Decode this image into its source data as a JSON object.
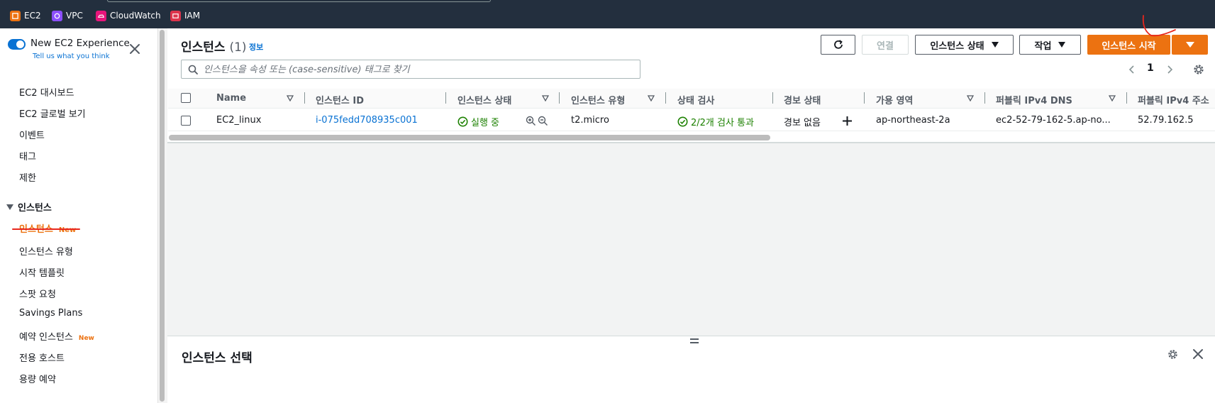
{
  "favorites": [
    {
      "label": "EC2",
      "color": "#ec7211"
    },
    {
      "label": "VPC",
      "color": "#8c4fff"
    },
    {
      "label": "CloudWatch",
      "color": "#e7157b"
    },
    {
      "label": "IAM",
      "color": "#dd344c"
    }
  ],
  "sidebar": {
    "experience_label": "New EC2 Experience",
    "feedback_link": "Tell us what you think",
    "items_top": [
      "EC2 대시보드",
      "EC2 글로벌 보기",
      "이벤트",
      "태그",
      "제한"
    ],
    "section_title": "인스턴스",
    "active_item": "인스턴스",
    "active_badge": "New",
    "items_bottom": [
      "인스턴스 유형",
      "시작 템플릿",
      "스팟 요청",
      "Savings Plans",
      "예약 인스턴스",
      "전용 호스트",
      "용량 예약"
    ],
    "reserved_badge": "New"
  },
  "header": {
    "title": "인스턴스",
    "count": "(1)",
    "info": "정보",
    "connect": "연결",
    "instance_state": "인스턴스 상태",
    "actions": "작업",
    "launch": "인스턴스 시작"
  },
  "search": {
    "placeholder": "인스턴스을 속성 또는 (case-sensitive) 태그로 찾기"
  },
  "pagination": {
    "page": "1"
  },
  "table": {
    "columns": [
      "Name",
      "인스턴스 ID",
      "인스턴스 상태",
      "인스턴스 유형",
      "상태 검사",
      "경보 상태",
      "가용 영역",
      "퍼블릭 IPv4 DNS",
      "퍼블릭 IPv4 주소"
    ],
    "rows": [
      {
        "name": "EC2_linux",
        "id": "i-075fedd708935c001",
        "state": "실행 중",
        "type": "t2.micro",
        "check": "2/2개 검사 통과",
        "alarm": "경보 없음",
        "az": "ap-northeast-2a",
        "dns": "ec2-52-79-162-5.ap-no...",
        "ip": "52.79.162.5"
      }
    ]
  },
  "bottom": {
    "title": "인스턴스 선택"
  },
  "colors": {
    "accent": "#ec7211",
    "link": "#0972d3",
    "success": "#1d8102",
    "nav_bg": "#232f3e"
  }
}
